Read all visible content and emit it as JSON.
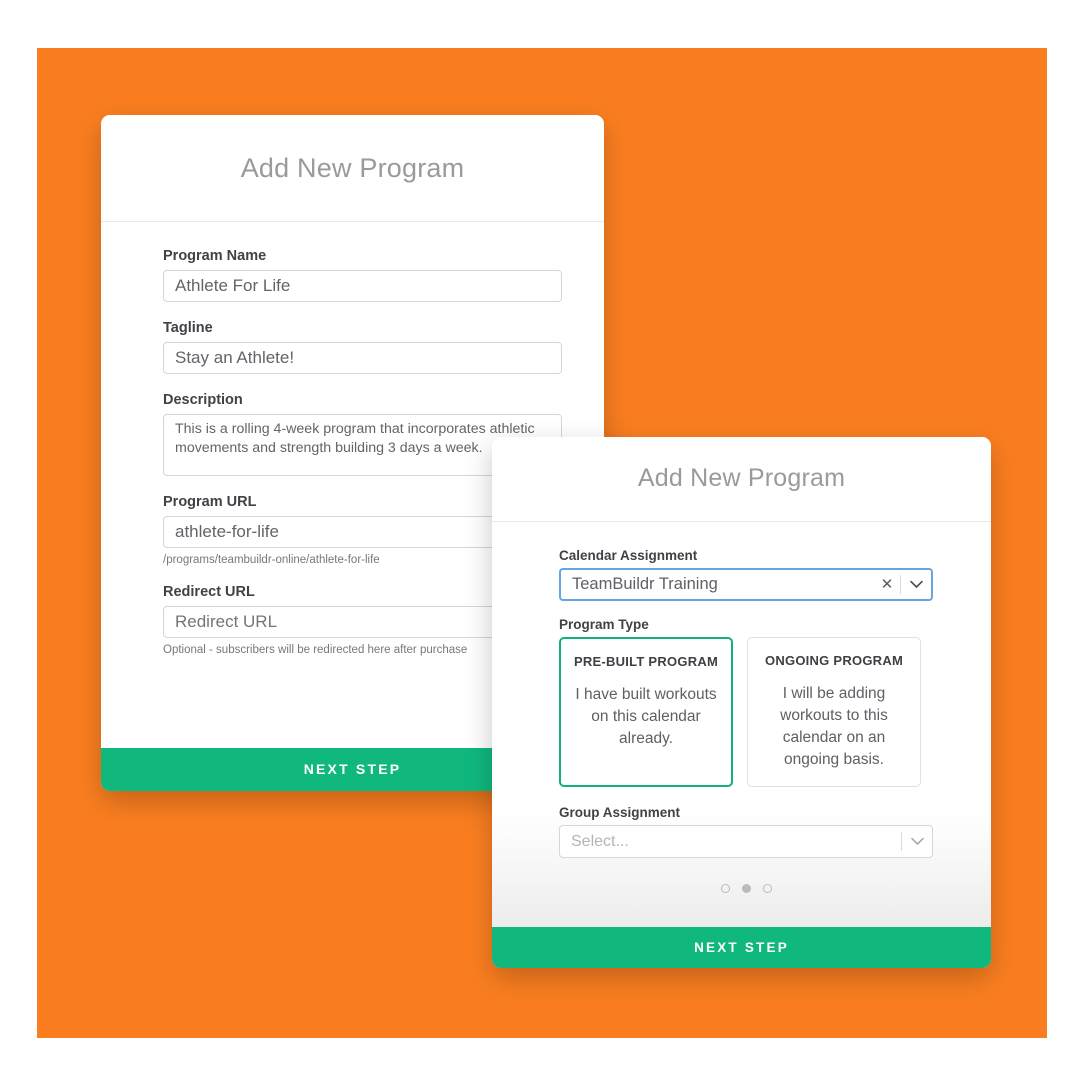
{
  "theme": {
    "backdrop_color": "#FA7E20",
    "accent_green": "#10B87E",
    "focus_blue": "#6AA4E0",
    "selected_green": "#12B07A",
    "label_color": "#3F4246"
  },
  "modal_step1": {
    "title": "Add New Program",
    "fields": {
      "program_name": {
        "label": "Program Name",
        "value": "Athlete For Life"
      },
      "tagline": {
        "label": "Tagline",
        "value": "Stay an Athlete!"
      },
      "description": {
        "label": "Description",
        "value": "This is a rolling 4-week program that incorporates athletic movements and strength building 3 days a week."
      },
      "program_url": {
        "label": "Program URL",
        "value": "athlete-for-life",
        "helper": "/programs/teambuildr-online/athlete-for-life"
      },
      "redirect_url": {
        "label": "Redirect URL",
        "value": "",
        "placeholder": "Redirect URL",
        "helper": "Optional - subscribers will be redirected here after purchase"
      }
    },
    "next_button_label": "NEXT STEP"
  },
  "modal_step2": {
    "title": "Add New Program",
    "calendar_assignment": {
      "label": "Calendar Assignment",
      "value": "TeamBuildr Training",
      "clear_icon": "close-x-icon",
      "dropdown_icon": "chevron-down-icon"
    },
    "program_type": {
      "label": "Program Type",
      "options": [
        {
          "title": "PRE-BUILT PROGRAM",
          "description": "I have built workouts on this calendar already.",
          "selected": true
        },
        {
          "title": "ONGOING PROGRAM",
          "description": "I will be adding workouts to this calendar on an ongoing basis.",
          "selected": false
        }
      ]
    },
    "group_assignment": {
      "label": "Group Assignment",
      "value": "",
      "placeholder": "Select...",
      "dropdown_icon": "chevron-down-icon"
    },
    "pagination": {
      "total": 3,
      "active_index": 1
    },
    "next_button_label": "NEXT STEP"
  }
}
